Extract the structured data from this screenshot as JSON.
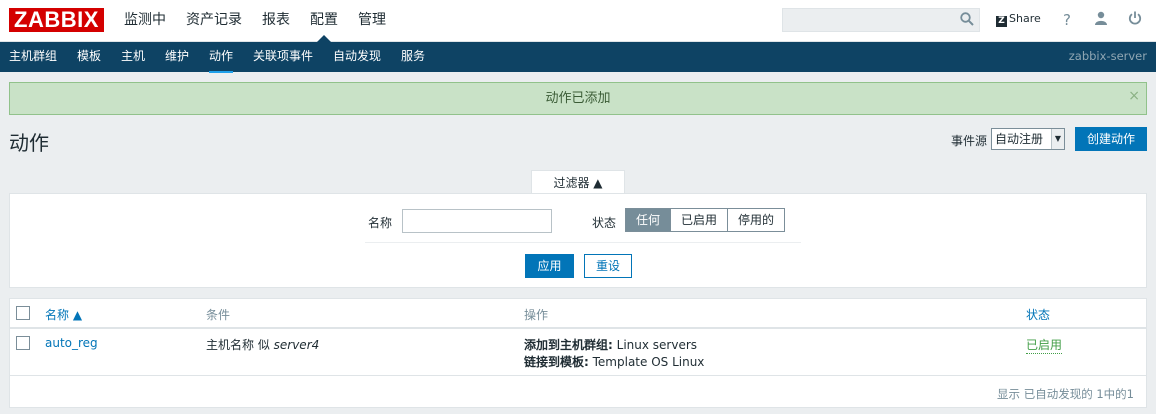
{
  "brand": {
    "logo": "ZABBIX"
  },
  "main_menu": [
    "监测中",
    "资产记录",
    "报表",
    "配置",
    "管理"
  ],
  "main_menu_active": "配置",
  "top_right": {
    "share": "Share",
    "help_icon": "help-icon",
    "user_icon": "user-icon",
    "logout_icon": "power-icon",
    "search_value": ""
  },
  "sub_menu": [
    "主机群组",
    "模板",
    "主机",
    "维护",
    "动作",
    "关联项事件",
    "自动发现",
    "服务"
  ],
  "sub_menu_active": "动作",
  "server_name": "zabbix-server",
  "message": "动作已添加",
  "page": {
    "title": "动作",
    "event_source_label": "事件源",
    "event_source_value": "自动注册",
    "create_button": "创建动作"
  },
  "filter": {
    "tab_label": "过滤器 ▲",
    "name_label": "名称",
    "name_value": "",
    "status_label": "状态",
    "status_options": [
      "任何",
      "已启用",
      "停用的"
    ],
    "status_selected": "任何",
    "apply_button": "应用",
    "reset_button": "重设"
  },
  "table": {
    "columns": {
      "name": "名称 ▲",
      "conditions": "条件",
      "operations": "操作",
      "status": "状态"
    },
    "rows": [
      {
        "name": "auto_reg",
        "condition_prefix": "主机名称 似 ",
        "condition_value": "server4",
        "op1_label": "添加到主机群组:",
        "op1_value": " Linux servers",
        "op2_label": "链接到模板:",
        "op2_value": " Template OS Linux",
        "status": "已启用"
      }
    ],
    "footer": "显示 已自动发现的 1中的1"
  },
  "colors": {
    "header": "#0e4364",
    "accent": "#0275b8",
    "logo": "#d40000",
    "enabled": "#429e47",
    "success_bg": "#c9e2c7"
  }
}
